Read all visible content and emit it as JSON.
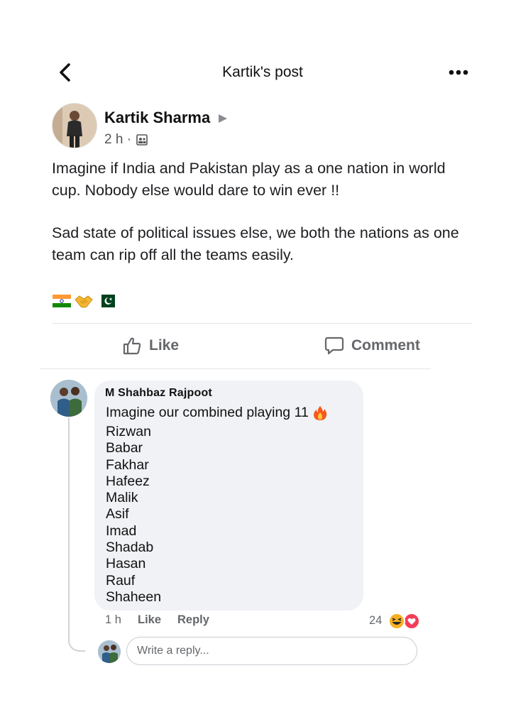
{
  "header": {
    "title": "Kartik's post",
    "icons": {
      "back": "chevron-left-icon",
      "more": "more-dots-icon"
    }
  },
  "post": {
    "author": "Kartik Sharma",
    "time": "2 h ·",
    "audience_icon": "custom-audience-icon",
    "paragraphs": [
      "Imagine if India and Pakistan play as a one nation in world cup. Nobody else would dare to win ever !!",
      "Sad state of political issues else, we both the nations as one team can rip off all the teams easily."
    ],
    "emojis": [
      "india-flag",
      "handshake",
      "pakistan-flag"
    ]
  },
  "actions": {
    "like_label": "Like",
    "comment_label": "Comment"
  },
  "comment": {
    "author": "M Shahbaz Rajpoot",
    "first_line": "Imagine our combined playing 11",
    "first_line_emoji": "fire",
    "players": [
      "Rizwan",
      "Babar",
      "Fakhar",
      "Hafeez",
      "Malik",
      "Asif",
      "Imad",
      "Shadab",
      "Hasan",
      "Rauf",
      "Shaheen"
    ],
    "time": "1 h",
    "like_label": "Like",
    "reply_label": "Reply",
    "reaction_count": "24",
    "reactions": [
      "haha",
      "love"
    ]
  },
  "reply_box": {
    "placeholder": "Write a reply..."
  },
  "colors": {
    "text": "#1c1e21",
    "secondary": "#65676b",
    "bubble": "#f0f2f5",
    "love": "#f33e58",
    "haha": "#f7b125"
  }
}
